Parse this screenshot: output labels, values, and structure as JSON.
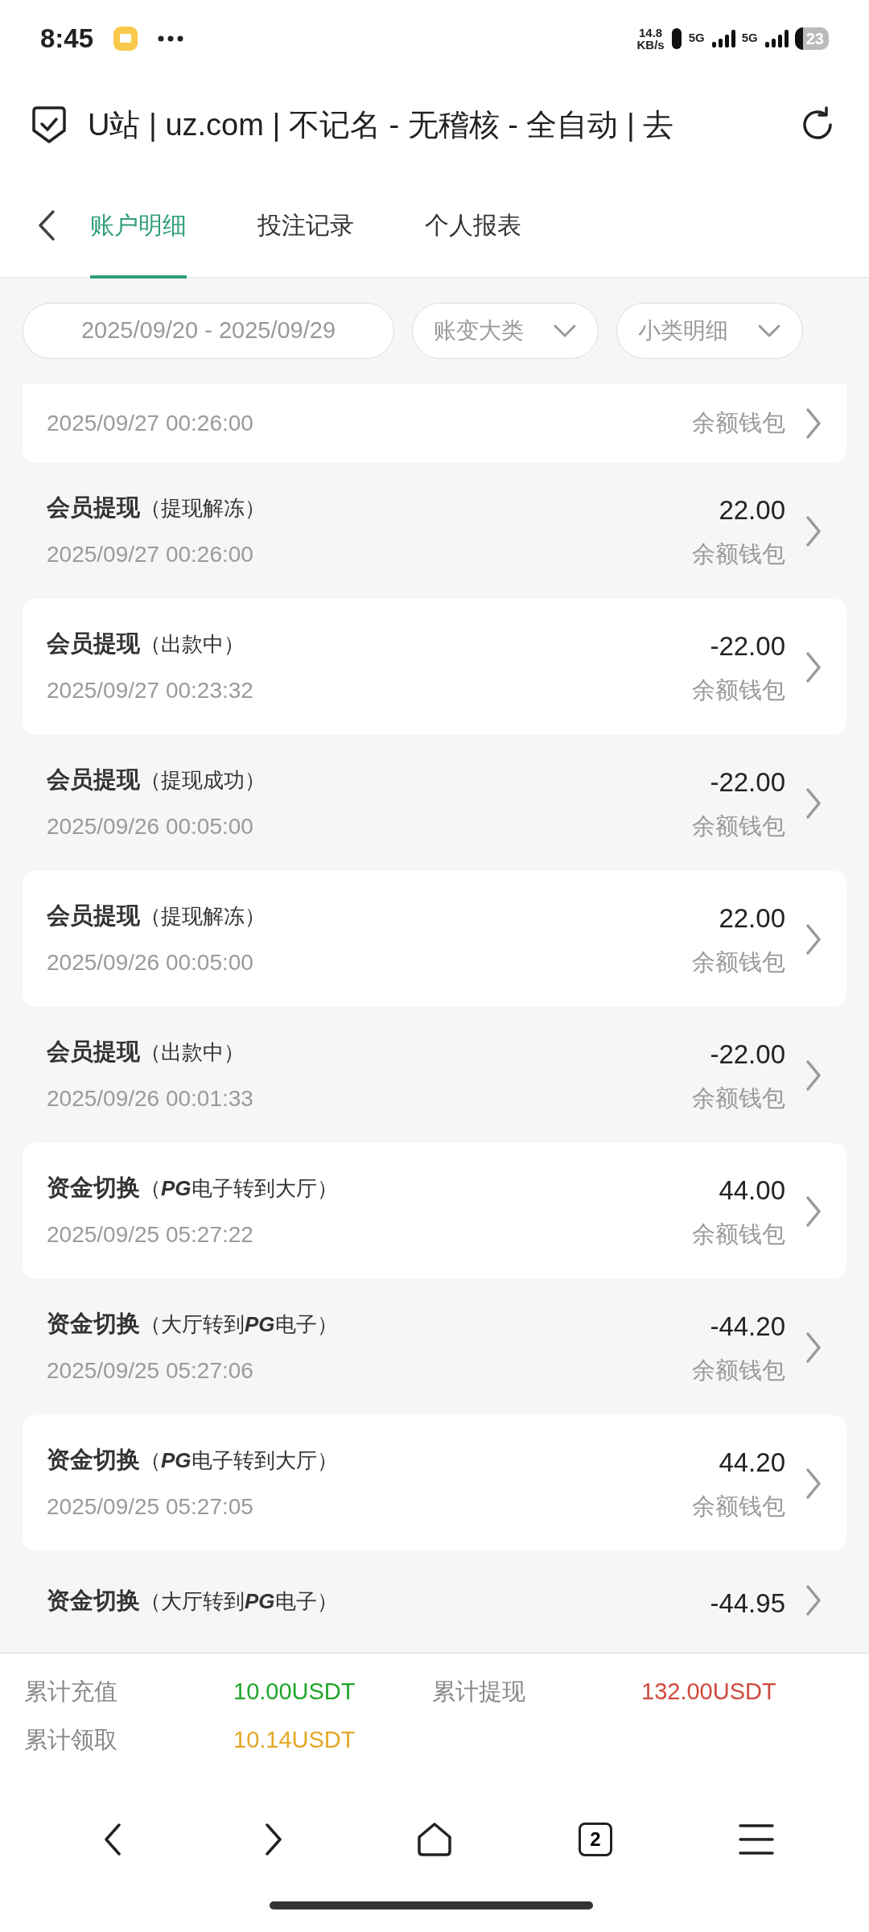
{
  "status_bar": {
    "time": "8:45",
    "net_speed": [
      "14.8",
      "KB/s"
    ],
    "networks": [
      "5G",
      "5G"
    ],
    "battery": "23"
  },
  "address_bar": {
    "title": "U站 | uz.com | 不记名 - 无稽核 - 全自动 | 去"
  },
  "tabs": [
    {
      "label": "账户明细",
      "selected": true
    },
    {
      "label": "投注记录",
      "selected": false
    },
    {
      "label": "个人报表",
      "selected": false
    }
  ],
  "filters": {
    "date_range": "2025/09/20 - 2025/09/29",
    "category": "账变大类",
    "subcategory": "小类明细"
  },
  "records": [
    {
      "time": "2025/09/27 00:26:00",
      "wallet": "余额钱包"
    },
    {
      "title": "会员提现",
      "note": "（提现解冻）",
      "amount": "22.00",
      "time": "2025/09/27 00:26:00",
      "wallet": "余额钱包"
    },
    {
      "title": "会员提现",
      "note": "（出款中）",
      "amount": "-22.00",
      "time": "2025/09/27 00:23:32",
      "wallet": "余额钱包"
    },
    {
      "title": "会员提现",
      "note": "（提现成功）",
      "amount": "-22.00",
      "time": "2025/09/26 00:05:00",
      "wallet": "余额钱包"
    },
    {
      "title": "会员提现",
      "note": "（提现解冻）",
      "amount": "22.00",
      "time": "2025/09/26 00:05:00",
      "wallet": "余额钱包"
    },
    {
      "title": "会员提现",
      "note": "（出款中）",
      "amount": "-22.00",
      "time": "2025/09/26 00:01:33",
      "wallet": "余额钱包"
    },
    {
      "title": "资金切换",
      "note": "（**PG**电子转到大厅）",
      "amount": "44.00",
      "time": "2025/09/25 05:27:22",
      "wallet": "余额钱包"
    },
    {
      "title": "资金切换",
      "note": "（大厅转到**PG**电子）",
      "amount": "-44.20",
      "time": "2025/09/25 05:27:06",
      "wallet": "余额钱包"
    },
    {
      "title": "资金切换",
      "note": "（**PG**电子转到大厅）",
      "amount": "44.20",
      "time": "2025/09/25 05:27:05",
      "wallet": "余额钱包"
    },
    {
      "title": "资金切换",
      "note": "（大厅转到**PG**电子）",
      "amount": "-44.95"
    }
  ],
  "summary": [
    {
      "label": "累计充值",
      "value": "10.00USDT",
      "color": "#22a52a"
    },
    {
      "label": "累计提现",
      "value": "132.00USDT",
      "color": "#d04a3e"
    },
    {
      "label": "累计领取",
      "value": "10.14USDT",
      "color": "#e5a826"
    }
  ],
  "tab_count": "2"
}
